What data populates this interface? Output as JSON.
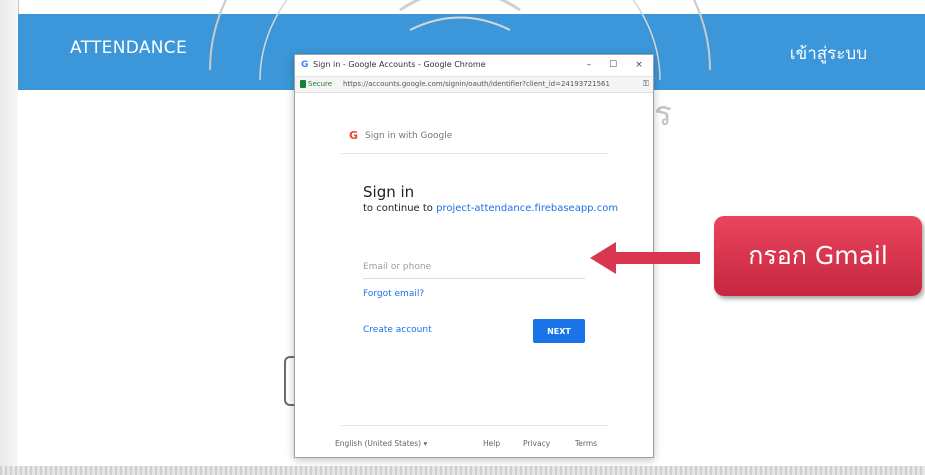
{
  "app": {
    "title": "ATTENDANCE",
    "login_label": "เข้าสู่ระบบ"
  },
  "popup": {
    "window_title": "Sign in - Google Accounts - Google Chrome",
    "secure_label": "Secure",
    "url": "https://accounts.google.com/signin/oauth/identifier?client_id=24193721561",
    "controls": {
      "minimize": "–",
      "maximize": "☐",
      "close": "×"
    }
  },
  "signin": {
    "header": "Sign in with Google",
    "heading": "Sign in",
    "continue_prefix": "to continue to",
    "continue_link": "project-attendance.firebaseapp.com",
    "email_placeholder": "Email or phone",
    "email_value": "",
    "forgot_email": "Forgot email?",
    "create_account": "Create account",
    "next_label": "NEXT"
  },
  "footer": {
    "language": "English (United States) ▾",
    "help": "Help",
    "privacy": "Privacy",
    "terms": "Terms"
  },
  "annotation": {
    "callout_text": "กรอก Gmail",
    "color": "#d93650"
  },
  "watermark": {
    "text": "จอมเกล้าเจ้าคุณทหาร"
  },
  "colors": {
    "header": "#3b97d9",
    "google_blue": "#1a73e8"
  }
}
